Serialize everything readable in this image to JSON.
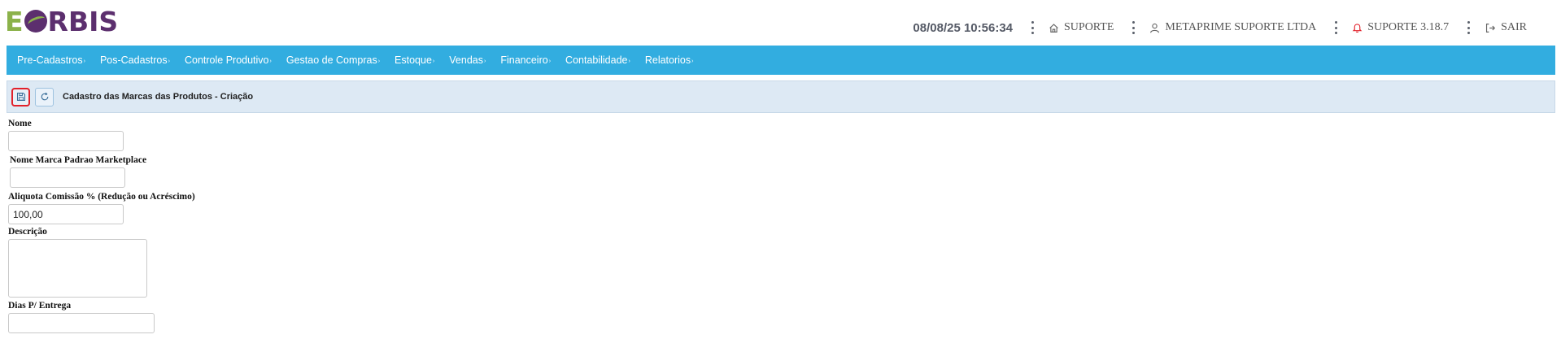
{
  "app": {
    "logo_text_first": "E",
    "logo_text_rest": "RBIS",
    "logo_colors": {
      "green": "#8bb24a",
      "purple": "#5c2f6e"
    }
  },
  "header": {
    "datetime": "08/08/25 10:56:34",
    "support_label": "SUPORTE",
    "company_label": "METAPRIME SUPORTE LTDA",
    "version_label": "SUPORTE 3.18.7",
    "logout_label": "SAIR",
    "icons": [
      "home-icon",
      "user-icon",
      "bell-icon",
      "logout-icon"
    ],
    "bell_color": "#e2202a"
  },
  "nav": {
    "color": "#32ade0",
    "items": [
      {
        "label": "Pre-Cadastros"
      },
      {
        "label": "Pos-Cadastros"
      },
      {
        "label": "Controle Produtivo"
      },
      {
        "label": "Gestao de Compras"
      },
      {
        "label": "Estoque"
      },
      {
        "label": "Vendas"
      },
      {
        "label": "Financeiro"
      },
      {
        "label": "Contabilidade"
      },
      {
        "label": "Relatorios"
      }
    ]
  },
  "toolbar": {
    "title": "Cadastro das Marcas das Produtos - Criação",
    "buttons": [
      "save-icon",
      "refresh-icon"
    ]
  },
  "form": {
    "nome": {
      "label": "Nome",
      "value": ""
    },
    "marca_padrao": {
      "label": "Nome Marca Padrao Marketplace",
      "value": ""
    },
    "aliquota": {
      "label": "Aliquota Comissão % (Redução ou Acréscimo)",
      "value": "100,00"
    },
    "descricao": {
      "label": "Descrição",
      "value": ""
    },
    "dias_entrega": {
      "label": "Dias P/ Entrega",
      "value": ""
    }
  }
}
